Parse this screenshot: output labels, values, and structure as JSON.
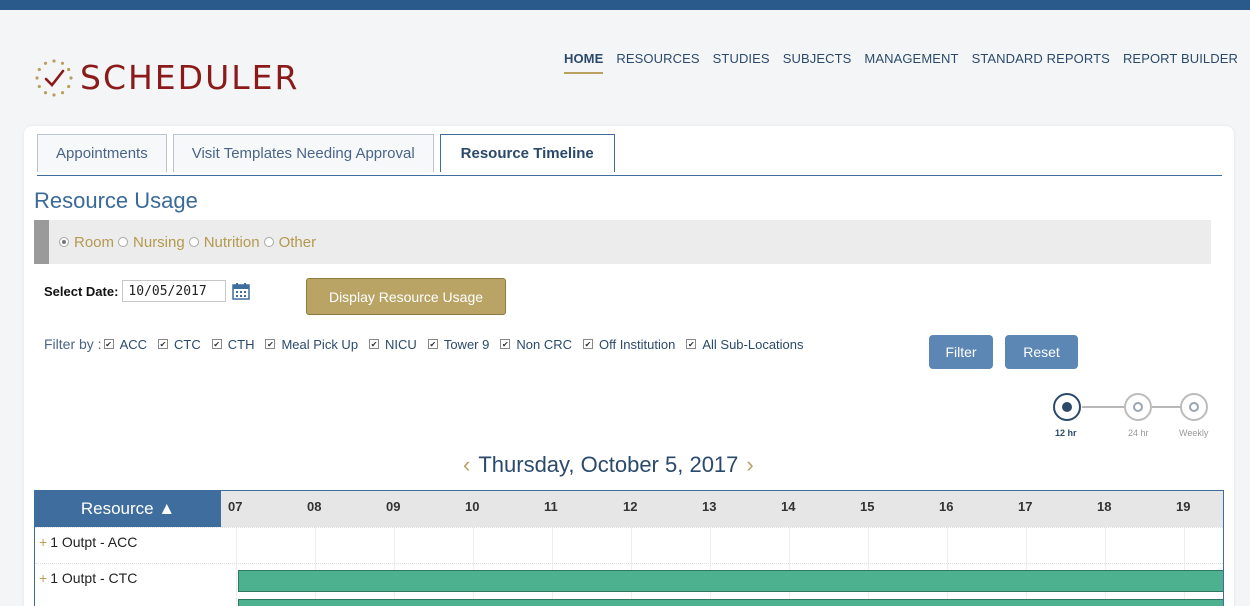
{
  "app": {
    "name": "SCHEDULER",
    "accent": "#b9a05e",
    "brand_color": "#8b1a1a",
    "primary_blue": "#3f6e9e"
  },
  "nav": {
    "items": [
      "HOME",
      "RESOURCES",
      "STUDIES",
      "SUBJECTS",
      "MANAGEMENT",
      "STANDARD REPORTS",
      "REPORT BUILDER"
    ],
    "active": "HOME"
  },
  "tabs": [
    {
      "label": "Appointments",
      "active": false
    },
    {
      "label": "Visit Templates Needing Approval",
      "active": false
    },
    {
      "label": "Resource Timeline",
      "active": true
    }
  ],
  "section": {
    "title": "Resource Usage"
  },
  "resource_types": {
    "options": [
      "Room",
      "Nursing",
      "Nutrition",
      "Other"
    ],
    "selected": "Room"
  },
  "date_select": {
    "label": "Select Date:",
    "value": "10/05/2017",
    "icon": "calendar-icon",
    "display_button": "Display Resource Usage"
  },
  "filters": {
    "label": "Filter by :",
    "items": [
      "ACC",
      "CTC",
      "CTH",
      "Meal Pick Up",
      "NICU",
      "Tower 9",
      "Non CRC",
      "Off Institution",
      "All Sub-Locations"
    ],
    "checked": [
      true,
      true,
      true,
      true,
      true,
      true,
      true,
      true,
      true
    ],
    "filter_button": "Filter",
    "reset_button": "Reset"
  },
  "zoom": {
    "options": [
      "12 hr",
      "24 hr",
      "Weekly"
    ],
    "selected": "12 hr"
  },
  "timeline": {
    "date_title": "Thursday, October 5, 2017",
    "prev_icon": "chevron-left-icon",
    "next_icon": "chevron-right-icon",
    "resource_header": "Resource ▲",
    "hours": [
      "07",
      "08",
      "09",
      "10",
      "11",
      "12",
      "13",
      "14",
      "15",
      "16",
      "17",
      "18",
      "19"
    ],
    "rows": [
      {
        "label": "1 Outpt - ACC",
        "booked": false
      },
      {
        "label": "1 Outpt - CTC",
        "booked": true
      }
    ]
  }
}
